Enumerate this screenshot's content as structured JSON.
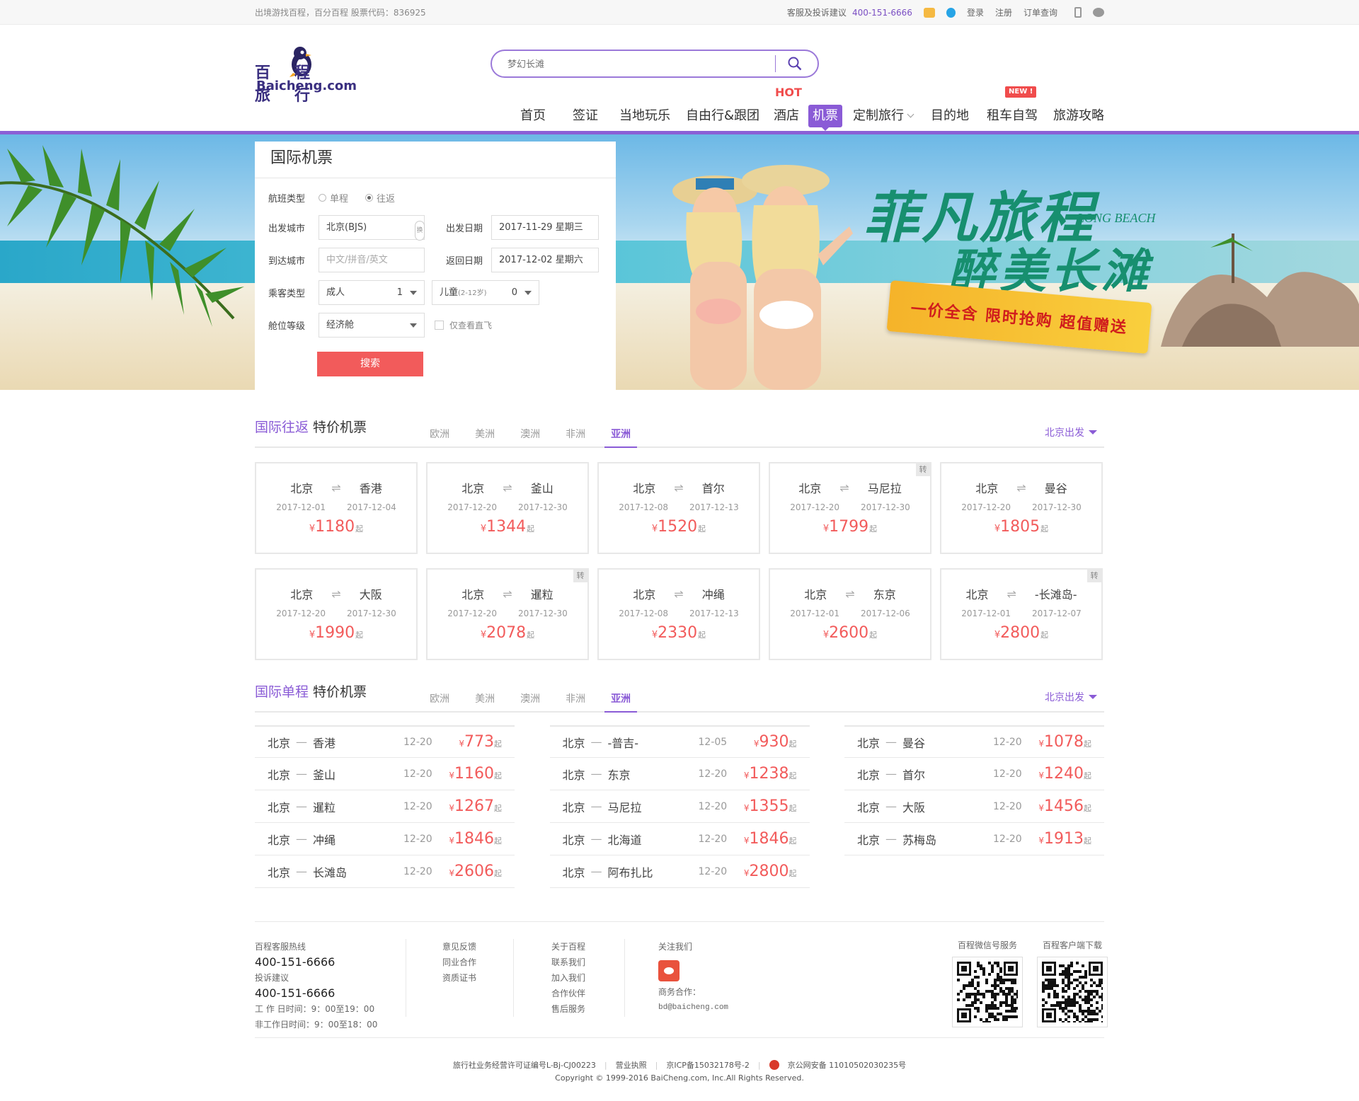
{
  "topbar": {
    "slogan": "出境游找百程，百分百程  股票代码：836925",
    "service_label": "客服及投诉建议",
    "service_phone": "400-151-6666",
    "login": "登录",
    "register": "注册",
    "orders": "订单查询"
  },
  "logo": {
    "cn": "百程旅行",
    "en": "Baicheng.com"
  },
  "search": {
    "placeholder": "梦幻长滩"
  },
  "nav": {
    "items": [
      "首页",
      "签证",
      "当地玩乐",
      "自由行&跟团",
      "酒店",
      "机票",
      "定制旅行",
      "目的地",
      "租车自驾",
      "旅游攻略"
    ],
    "hot": "HOT",
    "new": "NEW !"
  },
  "banner": {
    "title1": "菲凡旅程",
    "title2": "醉美长滩",
    "en": "LONG BEACH",
    "ribbon": "一价全含  限时抢购  超值赠送"
  },
  "form": {
    "title": "国际机票",
    "trip_type_label": "航班类型",
    "oneway": "单程",
    "roundtrip": "往返",
    "from_label": "出发城市",
    "from_value": "北京(BJS)",
    "to_label": "到达城市",
    "to_placeholder": "中文/拼音/英文",
    "swap": "换",
    "depart_date_label": "出发日期",
    "depart_date": "2017-11-29 星期三",
    "return_date_label": "返回日期",
    "return_date": "2017-12-02 星期六",
    "passenger_label": "乘客类型",
    "adult": "成人",
    "adult_count": "1",
    "child": "儿童",
    "child_age": "(2-12岁)",
    "child_count": "0",
    "cabin_label": "舱位等级",
    "cabin": "经济舱",
    "direct_only": "仅查看直飞",
    "search_btn": "搜索"
  },
  "roundtrip": {
    "title_hl": "国际往返",
    "title": " 特价机票",
    "tabs": [
      "欧洲",
      "美洲",
      "澳洲",
      "非洲",
      "亚洲"
    ],
    "depart": "北京出发",
    "currency": "¥",
    "suffix": "起",
    "transfer": "转",
    "cards": [
      {
        "from": "北京",
        "to": "香港",
        "d1": "2017-12-01",
        "d2": "2017-12-04",
        "price": "1180",
        "transfer": false
      },
      {
        "from": "北京",
        "to": "釜山",
        "d1": "2017-12-20",
        "d2": "2017-12-30",
        "price": "1344",
        "transfer": false
      },
      {
        "from": "北京",
        "to": "首尔",
        "d1": "2017-12-08",
        "d2": "2017-12-13",
        "price": "1520",
        "transfer": false
      },
      {
        "from": "北京",
        "to": "马尼拉",
        "d1": "2017-12-20",
        "d2": "2017-12-30",
        "price": "1799",
        "transfer": true
      },
      {
        "from": "北京",
        "to": "曼谷",
        "d1": "2017-12-20",
        "d2": "2017-12-30",
        "price": "1805",
        "transfer": false
      },
      {
        "from": "北京",
        "to": "大阪",
        "d1": "2017-12-20",
        "d2": "2017-12-30",
        "price": "1990",
        "transfer": false
      },
      {
        "from": "北京",
        "to": "暹粒",
        "d1": "2017-12-20",
        "d2": "2017-12-30",
        "price": "2078",
        "transfer": true
      },
      {
        "from": "北京",
        "to": "冲绳",
        "d1": "2017-12-08",
        "d2": "2017-12-13",
        "price": "2330",
        "transfer": false
      },
      {
        "from": "北京",
        "to": "东京",
        "d1": "2017-12-01",
        "d2": "2017-12-06",
        "price": "2600",
        "transfer": false
      },
      {
        "from": "北京",
        "to": "-长滩岛-",
        "d1": "2017-12-01",
        "d2": "2017-12-07",
        "price": "2800",
        "transfer": true
      }
    ]
  },
  "oneway": {
    "title_hl": "国际单程",
    "title": " 特价机票",
    "tabs": [
      "欧洲",
      "美洲",
      "澳洲",
      "非洲",
      "亚洲"
    ],
    "depart": "北京出发",
    "columns": [
      [
        {
          "from": "北京",
          "to": "香港",
          "date": "12-20",
          "price": "773"
        },
        {
          "from": "北京",
          "to": "釜山",
          "date": "12-20",
          "price": "1160"
        },
        {
          "from": "北京",
          "to": "暹粒",
          "date": "12-20",
          "price": "1267"
        },
        {
          "from": "北京",
          "to": "冲绳",
          "date": "12-20",
          "price": "1846"
        },
        {
          "from": "北京",
          "to": "长滩岛",
          "date": "12-20",
          "price": "2606"
        }
      ],
      [
        {
          "from": "北京",
          "to": "-普吉-",
          "date": "12-05",
          "price": "930"
        },
        {
          "from": "北京",
          "to": "东京",
          "date": "12-20",
          "price": "1238"
        },
        {
          "from": "北京",
          "to": "马尼拉",
          "date": "12-20",
          "price": "1355"
        },
        {
          "from": "北京",
          "to": "北海道",
          "date": "12-20",
          "price": "1846"
        },
        {
          "from": "北京",
          "to": "阿布扎比",
          "date": "12-20",
          "price": "2800"
        }
      ],
      [
        {
          "from": "北京",
          "to": "曼谷",
          "date": "12-20",
          "price": "1078"
        },
        {
          "from": "北京",
          "to": "首尔",
          "date": "12-20",
          "price": "1240"
        },
        {
          "from": "北京",
          "to": "大阪",
          "date": "12-20",
          "price": "1456"
        },
        {
          "from": "北京",
          "to": "苏梅岛",
          "date": "12-20",
          "price": "1913"
        }
      ]
    ]
  },
  "footer": {
    "hotline_label": "百程客服热线",
    "hotline": "400-151-6666",
    "complaint_label": "投诉建议",
    "complaint": "400-151-6666",
    "work_hours": "工 作 日时间：9：00至19：00",
    "off_hours": "非工作日时间：9：00至18：00",
    "links1": [
      "意见反馈",
      "同业合作",
      "资质证书"
    ],
    "links2": [
      "关于百程",
      "联系我们",
      "加入我们",
      "合作伙伴",
      "售后服务"
    ],
    "follow": "关注我们",
    "biz_label": "商务合作：",
    "biz_email": "bd@baicheng.com",
    "qr1": "百程微信号服务",
    "qr2": "百程客户端下载"
  },
  "bottom": {
    "license": "旅行社业务经营许可证编号L-Bj-CJ00223",
    "biz_license": "营业执照",
    "icp": "京ICP备15032178号-2",
    "police": "京公网安备 11010502030235号",
    "copyright": "Copyright © 1999-2016 BaiCheng.com, Inc.All Rights Reserved."
  },
  "colors": {
    "brand": "#8a5bd6",
    "price": "#f25b5b",
    "banner_text": "#178f6f"
  }
}
